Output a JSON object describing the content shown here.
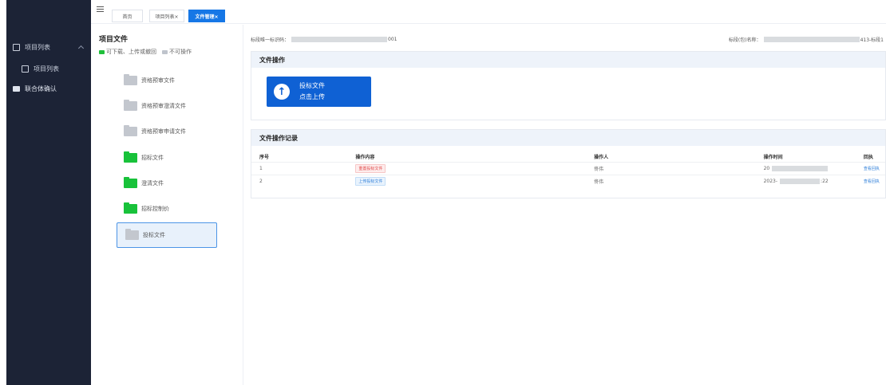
{
  "sidebar": {
    "items": [
      {
        "label": "项目列表",
        "icon": "folder-icon"
      },
      {
        "label": "项目列表",
        "icon": "folder-icon"
      },
      {
        "label": "联合体确认",
        "icon": "chat-icon"
      }
    ]
  },
  "tabs": [
    {
      "label": "首页",
      "active": false
    },
    {
      "label": "项目列表×",
      "active": true
    },
    {
      "label": "文件管理×",
      "active": true
    }
  ],
  "folder_panel": {
    "title": "项目文件",
    "legend": {
      "available": "可下载、上传或撤回",
      "unavailable": "不可操作"
    },
    "folders": [
      {
        "label": "资格预审文件",
        "state": "disabled"
      },
      {
        "label": "资格预审澄清文件",
        "state": "disabled"
      },
      {
        "label": "资格预审申请文件",
        "state": "disabled"
      },
      {
        "label": "招标文件",
        "state": "available"
      },
      {
        "label": "澄清文件",
        "state": "available"
      },
      {
        "label": "招标控制价",
        "state": "available"
      },
      {
        "label": "投标文件",
        "state": "selected"
      }
    ]
  },
  "header": {
    "id_label": "标段唯一标识码：",
    "id_suffix": "001",
    "name_label": "标段(包)名称：",
    "name_suffix": "413-标段1"
  },
  "file_ops": {
    "title": "文件操作",
    "upload_line1": "投标文件",
    "upload_line2": "点击上传"
  },
  "log": {
    "title": "文件操作记录",
    "columns": [
      "序号",
      "操作内容",
      "操作人",
      "操作时间",
      "回执"
    ],
    "rows": [
      {
        "no": "1",
        "action": "重置投标文件",
        "action_color": "red",
        "operator": "佟伟",
        "time_prefix": "20",
        "time_suffix": "",
        "receipt": "查看回执"
      },
      {
        "no": "2",
        "action": "上传投标文件",
        "action_color": "blue",
        "operator": "佟伟",
        "time_prefix": "2023-",
        "time_suffix": ":22",
        "receipt": "查看回执"
      }
    ]
  },
  "colors": {
    "sidebar_bg": "#1c2336",
    "accent_blue": "#1677e6",
    "upload_blue": "#0f61d4",
    "folder_green": "#18c23a",
    "folder_gray": "#c3c7ce"
  }
}
